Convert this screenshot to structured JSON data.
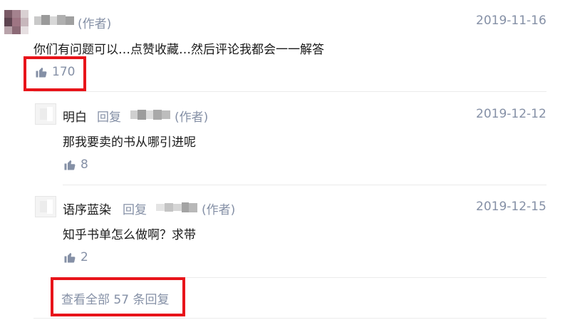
{
  "comments": [
    {
      "author_tag": "(作者)",
      "text": "你们有问题可以…点赞收藏…然后评论我都会一一解答",
      "date": "2019-11-16",
      "likes": "170",
      "highlighted_likes": true
    }
  ],
  "replies": [
    {
      "author": "明白",
      "reply_word": "回复",
      "target_tag": "(作者)",
      "text": "那我要卖的书从哪引进呢",
      "date": "2019-12-12",
      "likes": "8"
    },
    {
      "author": "语序蓝染",
      "reply_word": "回复",
      "target_tag": "(作者)",
      "text": "知乎书单怎么做啊？求带",
      "date": "2019-12-15",
      "likes": "2"
    }
  ],
  "view_all_replies": "查看全部 57 条回复",
  "colors": {
    "meta": "#8590a6",
    "highlight": "#e8141a",
    "text": "#1a1a1a"
  },
  "icons": {
    "like": "thumbs-up-icon"
  }
}
